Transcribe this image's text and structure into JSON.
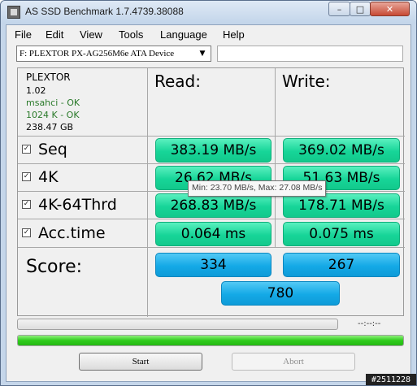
{
  "window": {
    "title": "AS SSD Benchmark 1.7.4739.38088",
    "controls": {
      "minimize": "–",
      "maximize": "□",
      "close": "✕"
    }
  },
  "menu": [
    "File",
    "Edit",
    "View",
    "Tools",
    "Language",
    "Help"
  ],
  "drive": {
    "selected": "F: PLEXTOR PX-AG256M6e ATA Device",
    "dropdown_icon": "▼",
    "text_field_value": ""
  },
  "device_info": {
    "name": "PLEXTOR",
    "firmware": "1.02",
    "driver_status": "msahci - OK",
    "alignment_status": "1024 K - OK",
    "capacity": "238.47 GB"
  },
  "columns": {
    "read": "Read:",
    "write": "Write:"
  },
  "tests": [
    {
      "label": "Seq",
      "checked": true,
      "read": "383.19 MB/s",
      "write": "369.02 MB/s"
    },
    {
      "label": "4K",
      "checked": true,
      "read": "26.62 MB/s",
      "write": "51.63 MB/s"
    },
    {
      "label": "4K-64Thrd",
      "checked": true,
      "read": "268.83 MB/s",
      "write": "178.71 MB/s"
    },
    {
      "label": "Acc.time",
      "checked": true,
      "read": "0.064 ms",
      "write": "0.075 ms"
    }
  ],
  "tooltip": "Min: 23.70 MB/s, Max: 27.08 MB/s",
  "score": {
    "label": "Score:",
    "read": "334",
    "write": "267",
    "total": "780"
  },
  "progress": {
    "time_label": "--:--:--",
    "current_fraction": 0.0,
    "overall_fraction": 1.0
  },
  "buttons": {
    "start": "Start",
    "abort": "Abort"
  },
  "watermark": "#2511228",
  "colors": {
    "result_green": "#17d598",
    "score_blue": "#14a9e6",
    "progress_green": "#2fcc1c",
    "ok_text": "#2a7a2a"
  }
}
